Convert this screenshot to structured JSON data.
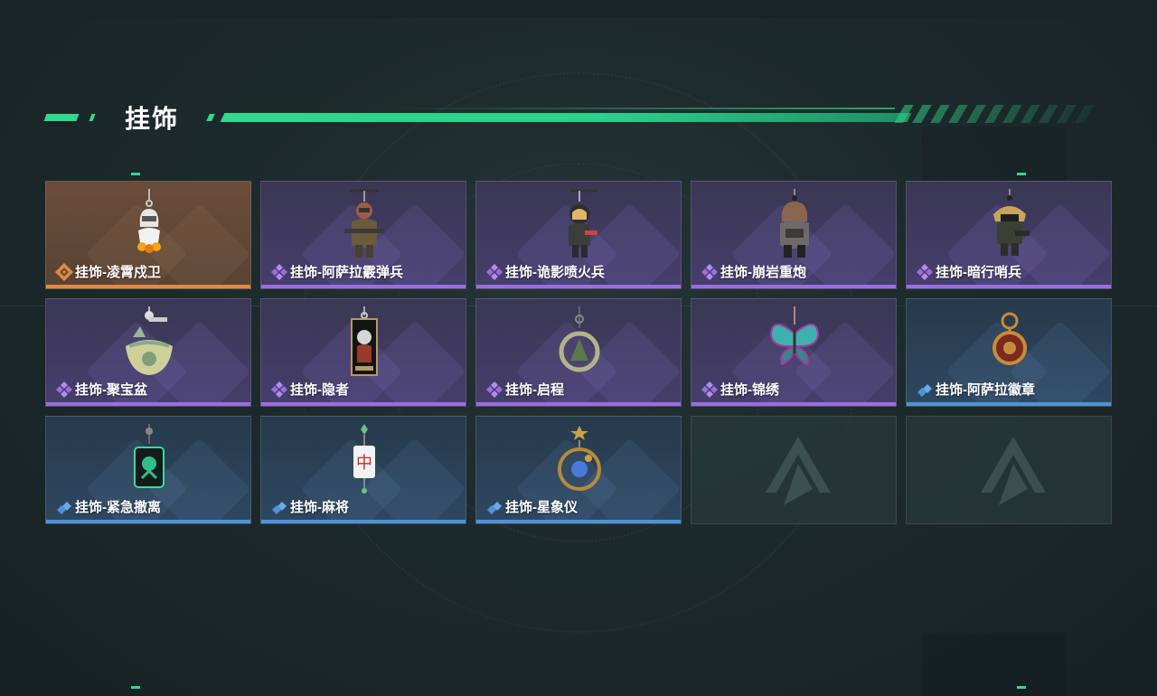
{
  "section": {
    "title": "挂饰"
  },
  "colors": {
    "accent": "#2fd98d",
    "orange": "#e08a44",
    "purple": "#9a6ee0",
    "blue": "#4d93d8"
  },
  "items": [
    {
      "label": "挂饰-凌霄戍卫",
      "rarity": "orange",
      "icon": "charm-duck-icon"
    },
    {
      "label": "挂饰-阿萨拉霰弹兵",
      "rarity": "purple",
      "icon": "charm-soldier-icon"
    },
    {
      "label": "挂饰-诡影喷火兵",
      "rarity": "purple",
      "icon": "charm-flamer-icon"
    },
    {
      "label": "挂饰-崩岩重炮",
      "rarity": "purple",
      "icon": "charm-gunner-icon"
    },
    {
      "label": "挂饰-暗行哨兵",
      "rarity": "purple",
      "icon": "charm-sentinel-icon"
    },
    {
      "label": "挂饰-聚宝盆",
      "rarity": "purple",
      "icon": "charm-treasure-bowl-icon"
    },
    {
      "label": "挂饰-隐者",
      "rarity": "purple",
      "icon": "charm-hermit-card-icon"
    },
    {
      "label": "挂饰-启程",
      "rarity": "purple",
      "icon": "charm-ring-icon"
    },
    {
      "label": "挂饰-锦绣",
      "rarity": "purple",
      "icon": "charm-butterfly-icon"
    },
    {
      "label": "挂饰-阿萨拉徽章",
      "rarity": "blue",
      "icon": "charm-badge-icon"
    },
    {
      "label": "挂饰-紧急撤离",
      "rarity": "blue",
      "icon": "charm-evac-icon"
    },
    {
      "label": "挂饰-麻将",
      "rarity": "blue",
      "icon": "charm-mahjong-icon"
    },
    {
      "label": "挂饰-星象仪",
      "rarity": "blue",
      "icon": "charm-astrolabe-icon"
    },
    {
      "label": "",
      "rarity": "empty",
      "icon": "empty-slot-logo-icon"
    },
    {
      "label": "",
      "rarity": "empty",
      "icon": "empty-slot-logo-icon"
    }
  ]
}
